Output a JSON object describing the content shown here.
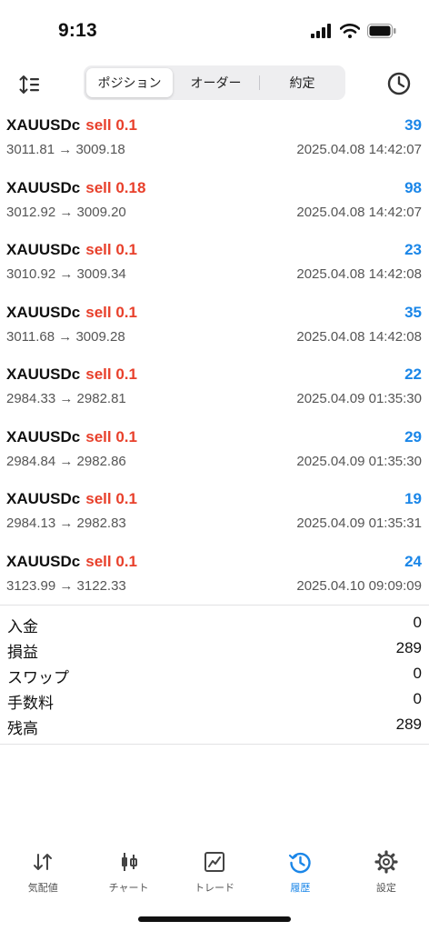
{
  "status_bar": {
    "time": "9:13"
  },
  "toolbar": {
    "segments": [
      {
        "label": "ポジション",
        "active": true
      },
      {
        "label": "オーダー",
        "active": false
      },
      {
        "label": "約定",
        "active": false
      }
    ]
  },
  "trades": [
    {
      "symbol": "XAUUSDc",
      "side": "sell 0.1",
      "profit": "39",
      "prices": "3011.81 → 3009.18",
      "time": "2025.04.08 14:42:07"
    },
    {
      "symbol": "XAUUSDc",
      "side": "sell 0.18",
      "profit": "98",
      "prices": "3012.92 → 3009.20",
      "time": "2025.04.08 14:42:07"
    },
    {
      "symbol": "XAUUSDc",
      "side": "sell 0.1",
      "profit": "23",
      "prices": "3010.92 → 3009.34",
      "time": "2025.04.08 14:42:08"
    },
    {
      "symbol": "XAUUSDc",
      "side": "sell 0.1",
      "profit": "35",
      "prices": "3011.68 → 3009.28",
      "time": "2025.04.08 14:42:08"
    },
    {
      "symbol": "XAUUSDc",
      "side": "sell 0.1",
      "profit": "22",
      "prices": "2984.33 → 2982.81",
      "time": "2025.04.09 01:35:30"
    },
    {
      "symbol": "XAUUSDc",
      "side": "sell 0.1",
      "profit": "29",
      "prices": "2984.84 → 2982.86",
      "time": "2025.04.09 01:35:30"
    },
    {
      "symbol": "XAUUSDc",
      "side": "sell 0.1",
      "profit": "19",
      "prices": "2984.13 → 2982.83",
      "time": "2025.04.09 01:35:31"
    },
    {
      "symbol": "XAUUSDc",
      "side": "sell 0.1",
      "profit": "24",
      "prices": "3123.99 → 3122.33",
      "time": "2025.04.10 09:09:09"
    }
  ],
  "summary": [
    {
      "label": "入金",
      "value": "0"
    },
    {
      "label": "損益",
      "value": "289"
    },
    {
      "label": "スワップ",
      "value": "0"
    },
    {
      "label": "手数料",
      "value": "0"
    },
    {
      "label": "残高",
      "value": "289"
    }
  ],
  "tabbar": {
    "tabs": [
      {
        "label": "気配値",
        "icon": "quotes-arrows-icon",
        "active": false
      },
      {
        "label": "チャート",
        "icon": "candlestick-chart-icon",
        "active": false
      },
      {
        "label": "トレード",
        "icon": "trade-chart-icon",
        "active": false
      },
      {
        "label": "履歴",
        "icon": "history-clock-icon",
        "active": true
      },
      {
        "label": "設定",
        "icon": "gear-icon",
        "active": false
      }
    ]
  },
  "colors": {
    "sell": "#e8402b",
    "profit": "#1a86e8",
    "active_tab": "#1a86e8"
  }
}
